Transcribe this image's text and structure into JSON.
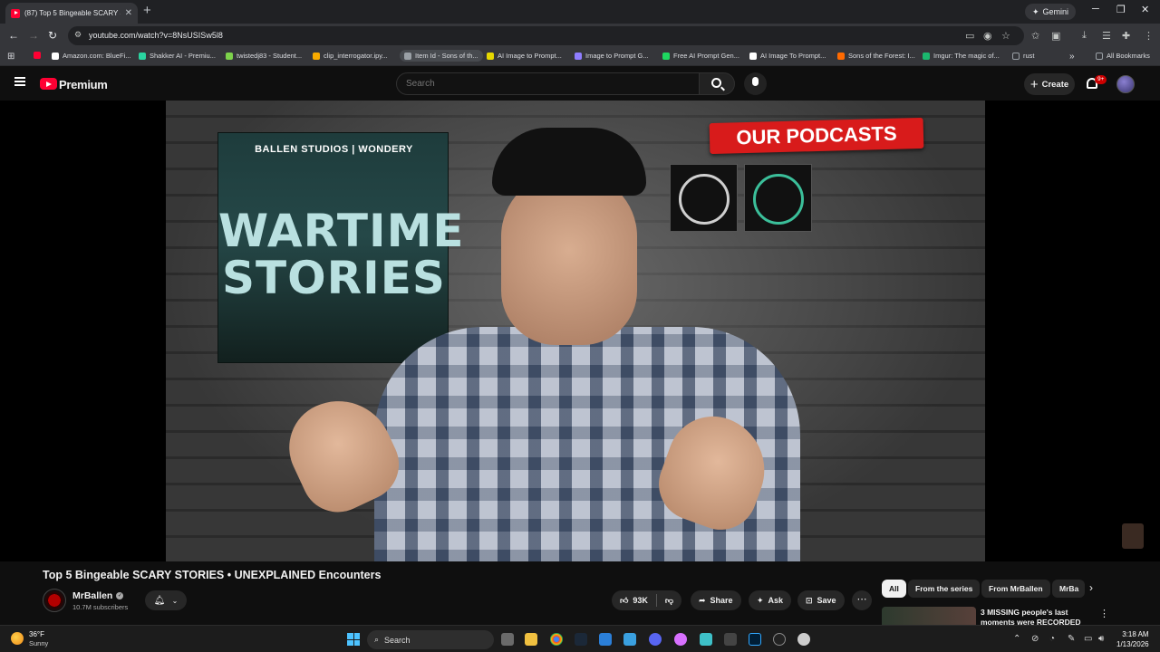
{
  "browser": {
    "tab_title": "(87) Top 5 Bingeable SCARY STORIES",
    "new_tab_symbol": "+",
    "gemini_label": "Gemini",
    "url": "youtube.com/watch?v=8NsUSISw5l8",
    "bookmarks": [
      {
        "label": "Amazon.com: BlueFi...",
        "color": "#ffffff"
      },
      {
        "label": "Shakker AI - Premiu...",
        "color": "#2ad4a0"
      },
      {
        "label": "twistedj83 - Student...",
        "color": "#7dd24b"
      },
      {
        "label": "clip_interrogator.ipy...",
        "color": "#f9ab00"
      },
      {
        "label": "Item Id - Sons of th...",
        "color": "#9aa0a6"
      },
      {
        "label": "AI Image to Prompt...",
        "color": "#e6d800"
      },
      {
        "label": "Image to Prompt G...",
        "color": "#8f7dff"
      },
      {
        "label": "Free AI Prompt Gen...",
        "color": "#1ed760"
      },
      {
        "label": "AI Image To Prompt...",
        "color": "#ffffff"
      },
      {
        "label": "Sons of the Forest: I...",
        "color": "#ff6a00"
      },
      {
        "label": "Imgur: The magic of...",
        "color": "#1bb76e"
      },
      {
        "label": "rust",
        "color": "#9aa0a6"
      }
    ],
    "all_bookmarks": "All Bookmarks"
  },
  "youtube": {
    "brand": "Premium",
    "search_placeholder": "Search",
    "create_label": "Create",
    "notification_badge": "9+"
  },
  "video": {
    "poster_studio": "BALLEN STUDIOS | WONDERY",
    "poster_title": "WARTIME STORIES",
    "podcasts_banner": "OUR PODCASTS",
    "title": "Top 5 Bingeable SCARY STORIES • UNEXPLAINED Encounters",
    "channel": "MrBallen",
    "subscribers": "10.7M subscribers",
    "likes": "93K",
    "share_label": "Share",
    "ask_label": "Ask",
    "save_label": "Save"
  },
  "recommendations": {
    "chips": [
      "All",
      "From the series",
      "From MrBallen",
      "MrBa"
    ],
    "first_title": "3 MISSING people's last moments were RECORDED"
  },
  "taskbar": {
    "temperature": "36°F",
    "condition": "Sunny",
    "search_label": "Search",
    "time": "3:18 AM",
    "date": "1/13/2026"
  },
  "colors": {
    "youtube_red": "#ff0033",
    "banner_red": "#d81b1b",
    "windows_blue": "#4cc2ff"
  }
}
